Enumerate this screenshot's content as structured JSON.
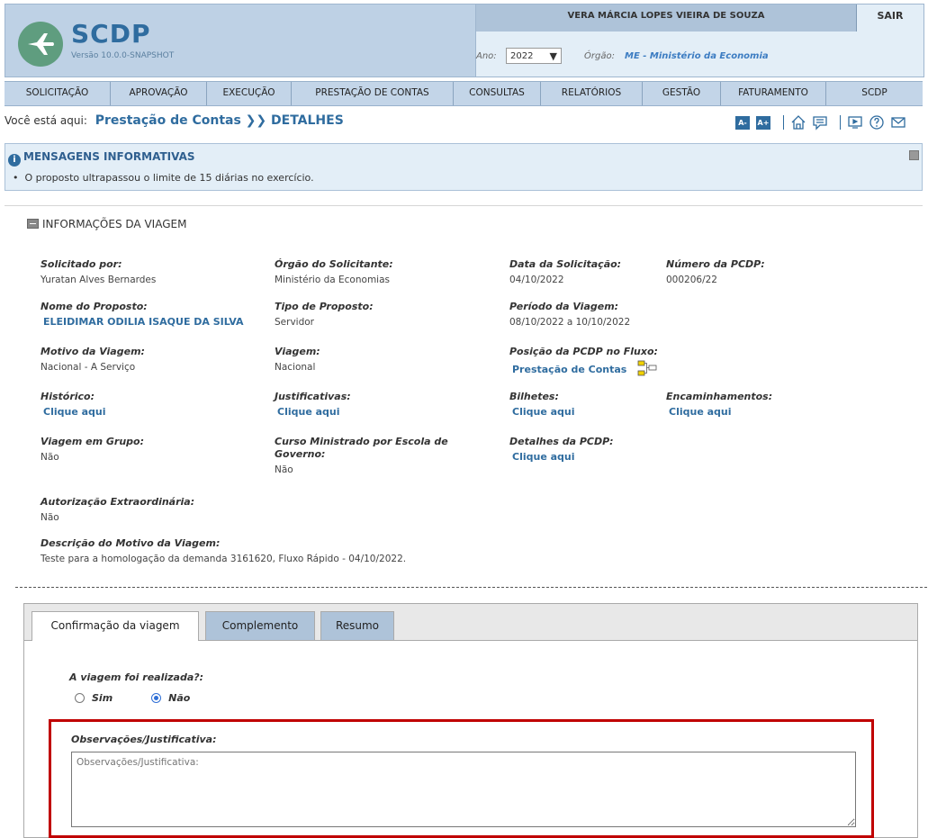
{
  "app": {
    "title": "SCDP",
    "version": "Versão 10.0.0-SNAPSHOT",
    "user_name": "VERA MÁRCIA LOPES VIEIRA DE SOUZA",
    "logout_label": "SAIR",
    "year_label": "Ano:",
    "year_value": "2022",
    "organ_label": "Órgão:",
    "organ_value": "ME - Ministério da Economia"
  },
  "menu": [
    "SOLICITAÇÃO",
    "APROVAÇÃO",
    "EXECUÇÃO",
    "PRESTAÇÃO DE CONTAS",
    "CONSULTAS",
    "RELATÓRIOS",
    "GESTÃO",
    "FATURAMENTO",
    "SCDP"
  ],
  "breadcrumb": {
    "prefix": "Você está aqui:",
    "current": "Prestação de Contas ❯❯ DETALHES"
  },
  "toolbar": {
    "font_decrease": "A-",
    "font_increase": "A+",
    "icons": [
      "home-icon",
      "chat-icon",
      "video-icon",
      "help-icon",
      "mail-icon"
    ]
  },
  "messages": {
    "title": "MENSAGENS INFORMATIVAS",
    "items": [
      "O proposto ultrapassou o limite de 15 diárias no exercício."
    ]
  },
  "trip": {
    "section_title": "INFORMAÇÕES DA VIAGEM",
    "solicitado_por_label": "Solicitado por:",
    "solicitado_por": "Yuratan Alves Bernardes",
    "orgao_solicitante_label": "Órgão do Solicitante:",
    "orgao_solicitante": "Ministério da Economias",
    "data_solicitacao_label": "Data da Solicitação:",
    "data_solicitacao": "04/10/2022",
    "numero_pcdp_label": "Número da PCDP:",
    "numero_pcdp": "000206/22",
    "nome_proposto_label": "Nome do Proposto:",
    "nome_proposto": "ELEIDIMAR ODILIA ISAQUE DA SILVA",
    "tipo_proposto_label": "Tipo de Proposto:",
    "tipo_proposto": "Servidor",
    "periodo_label": "Período da Viagem:",
    "periodo": "08/10/2022 a 10/10/2022",
    "motivo_label": "Motivo da Viagem:",
    "motivo": "Nacional - A Serviço",
    "viagem_label": "Viagem:",
    "viagem": "Nacional",
    "posicao_label": "Posição da PCDP no Fluxo:",
    "posicao": "Prestação de Contas",
    "historico_label": "Histórico:",
    "justificativas_label": "Justificativas:",
    "bilhetes_label": "Bilhetes:",
    "encaminhamentos_label": "Encaminhamentos:",
    "clique_aqui": "Clique aqui",
    "grupo_label": "Viagem em Grupo:",
    "grupo": "Não",
    "curso_label": "Curso Ministrado por Escola de Governo:",
    "curso": "Não",
    "detalhes_label": "Detalhes da PCDP:",
    "autorizacao_label": "Autorização Extraordinária:",
    "autorizacao": "Não",
    "descricao_label": "Descrição do Motivo da Viagem:",
    "descricao": "Teste para a homologação da demanda 3161620, Fluxo Rápido - 04/10/2022."
  },
  "tabs": {
    "items": [
      "Confirmação da viagem",
      "Complemento",
      "Resumo"
    ],
    "active": "Confirmação da viagem"
  },
  "confirmation": {
    "question": "A viagem foi realizada?:",
    "option_yes": "Sim",
    "option_no": "Não",
    "selected": "Não",
    "obs_label": "Observações/Justificativa:",
    "obs_placeholder": "Observações/Justificativa:"
  },
  "colors": {
    "header_bg": "#bed1e5",
    "menu_bg": "#c3d5e8",
    "link": "#2f6c9f",
    "highlight_border": "#c00000"
  }
}
